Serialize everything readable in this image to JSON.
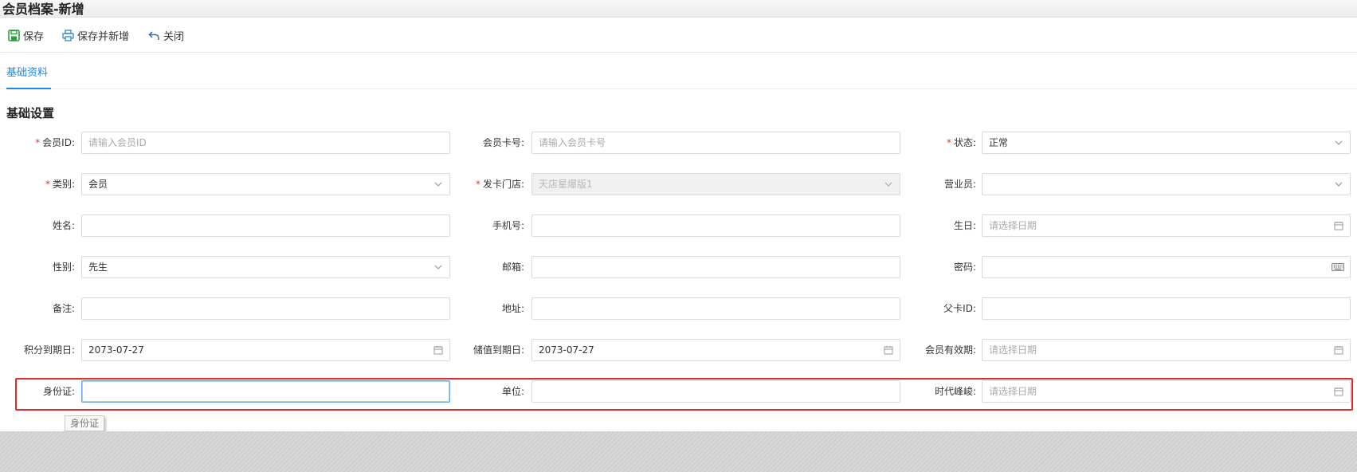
{
  "window": {
    "title": "会员档案-新增"
  },
  "toolbar": {
    "save_label": "保存",
    "save_new_label": "保存并新增",
    "close_label": "关闭"
  },
  "tabs": [
    {
      "label": "基础资料",
      "active": true
    }
  ],
  "section": {
    "title": "基础设置"
  },
  "fields": {
    "member_id": {
      "label": "会员ID:",
      "required": true,
      "placeholder": "请输入会员ID",
      "value": ""
    },
    "card_no": {
      "label": "会员卡号:",
      "required": false,
      "placeholder": "请输入会员卡号",
      "value": ""
    },
    "status": {
      "label": "状态:",
      "required": true,
      "value": "正常"
    },
    "category": {
      "label": "类别:",
      "required": true,
      "value": "会员"
    },
    "issue_store": {
      "label": "发卡门店:",
      "required": true,
      "value": "天店星爆版1",
      "disabled": true
    },
    "salesperson": {
      "label": "营业员:",
      "required": false,
      "value": ""
    },
    "name": {
      "label": "姓名:",
      "value": ""
    },
    "phone": {
      "label": "手机号:",
      "value": ""
    },
    "birthday": {
      "label": "生日:",
      "placeholder": "请选择日期",
      "value": ""
    },
    "gender": {
      "label": "性别:",
      "value": "先生"
    },
    "email": {
      "label": "邮箱:",
      "value": ""
    },
    "password": {
      "label": "密码:",
      "value": ""
    },
    "remark": {
      "label": "备注:",
      "value": ""
    },
    "address": {
      "label": "地址:",
      "value": ""
    },
    "parent_card": {
      "label": "父卡ID:",
      "value": ""
    },
    "points_expiry": {
      "label": "积分到期日:",
      "value": "2073-07-27"
    },
    "stored_value_expiry": {
      "label": "储值到期日:",
      "value": "2073-07-27"
    },
    "member_validity": {
      "label": "会员有效期:",
      "placeholder": "请选择日期",
      "value": ""
    },
    "id_card": {
      "label": "身份证:",
      "value": ""
    },
    "company": {
      "label": "单位:",
      "value": ""
    },
    "era_peak": {
      "label": "时代峰峻:",
      "placeholder": "请选择日期",
      "value": ""
    }
  },
  "tooltip": {
    "text": "身份证"
  },
  "colors": {
    "accent": "#1e88e5",
    "required": "#e53935",
    "highlight": "#e32b2b",
    "save_icon": "#2e9b3e"
  }
}
